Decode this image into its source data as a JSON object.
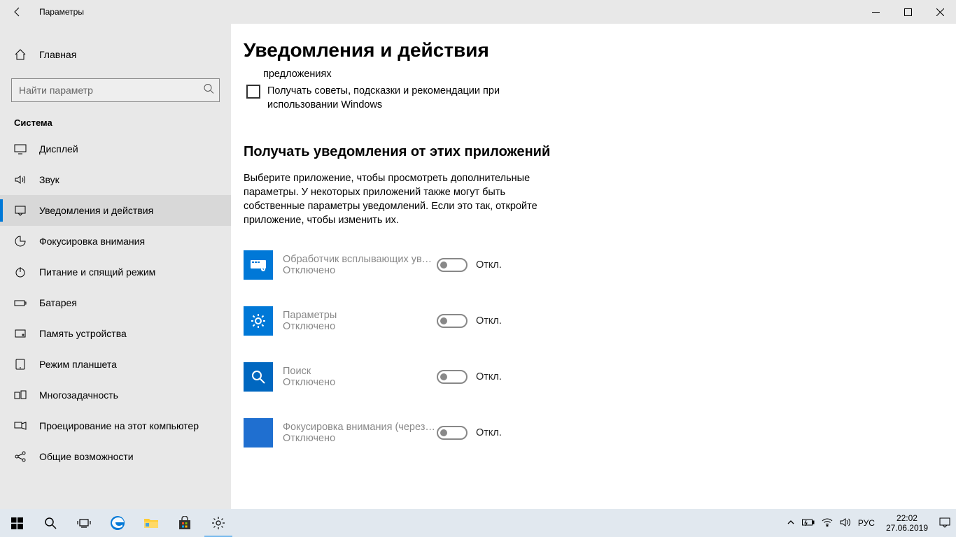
{
  "titlebar": {
    "title": "Параметры"
  },
  "sidebar": {
    "home": "Главная",
    "search_placeholder": "Найти параметр",
    "section": "Система",
    "items": [
      {
        "label": "Дисплей"
      },
      {
        "label": "Звук"
      },
      {
        "label": "Уведомления и действия"
      },
      {
        "label": "Фокусировка внимания"
      },
      {
        "label": "Питание и спящий режим"
      },
      {
        "label": "Батарея"
      },
      {
        "label": "Память устройства"
      },
      {
        "label": "Режим планшета"
      },
      {
        "label": "Многозадачность"
      },
      {
        "label": "Проецирование на этот компьютер"
      },
      {
        "label": "Общие возможности"
      }
    ]
  },
  "content": {
    "page_title": "Уведомления и действия",
    "trunc1": "предложениях",
    "chk2": "Получать советы, подсказки и рекомендации при использовании Windows",
    "subhead": "Получать уведомления от этих приложений",
    "desc": "Выберите приложение, чтобы просмотреть дополнительные параметры. У некоторых приложений также могут быть собственные параметры уведомлений. Если это так, откройте приложение, чтобы изменить их.",
    "off_short": "Откл.",
    "apps": [
      {
        "name": "Обработчик всплывающих увед…",
        "state": "Отключено"
      },
      {
        "name": "Параметры",
        "state": "Отключено"
      },
      {
        "name": "Поиск",
        "state": "Отключено"
      },
      {
        "name": "Фокусировка внимания (через…",
        "state": "Отключено"
      }
    ]
  },
  "taskbar": {
    "lang": "РУС",
    "time": "22:02",
    "date": "27.06.2019"
  }
}
